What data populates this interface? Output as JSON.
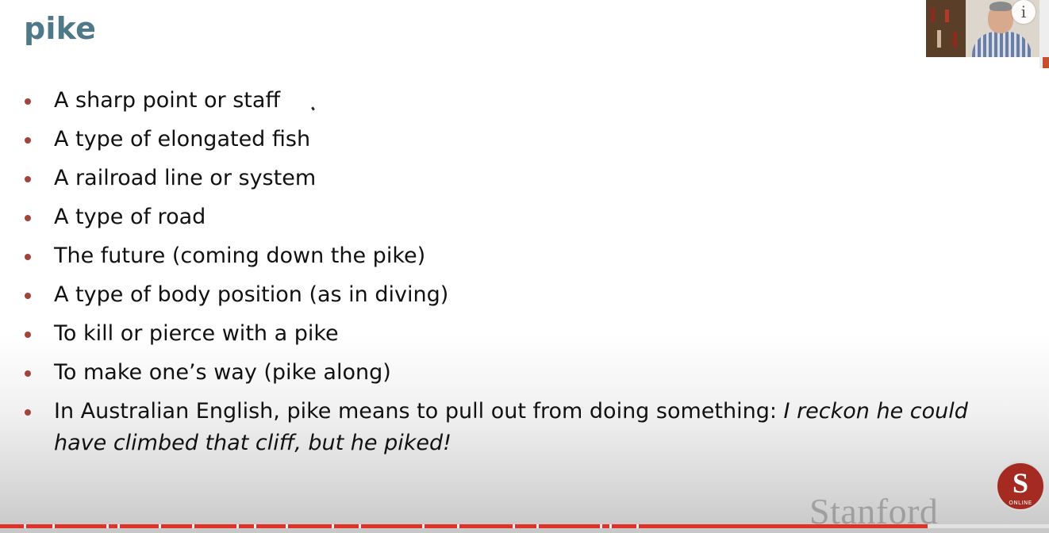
{
  "slide": {
    "title": "pike",
    "bullets": [
      {
        "text": "A sharp point or staff"
      },
      {
        "text": "A type of elongated fish"
      },
      {
        "text": "A railroad line or system"
      },
      {
        "text": "A type of road"
      },
      {
        "text": "The future (coming down the pike)"
      },
      {
        "text": "A type of body position (as in diving)"
      },
      {
        "text": "To kill or pierce with a pike"
      },
      {
        "text": "To make one’s way (pike along)"
      },
      {
        "text": "In Australian English, pike means to pull out from doing something: ",
        "italic": "I reckon he could have climbed that cliff, but he piked!"
      }
    ]
  },
  "overlay": {
    "info_icon": "info-icon",
    "info_glyph": "i",
    "webcam": "presenter-webcam"
  },
  "branding": {
    "wordmark": "Stanford",
    "seal_letter": "S",
    "seal_caption": "ONLINE"
  },
  "player": {
    "progress": 0.884
  },
  "colors": {
    "title": "#4f7889",
    "bullet": "#a0453b",
    "progress": "#e0322a",
    "seal": "#a52a22"
  }
}
